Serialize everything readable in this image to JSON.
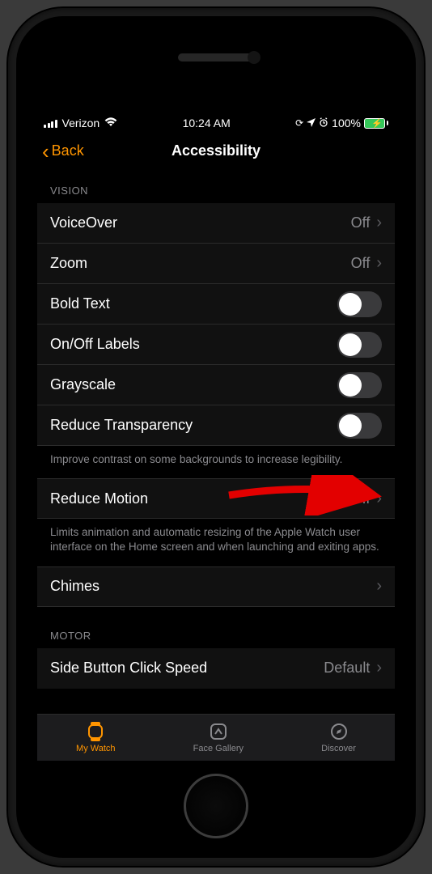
{
  "status": {
    "carrier": "Verizon",
    "time": "10:24 AM",
    "battery_pct": "100%"
  },
  "nav": {
    "back": "Back",
    "title": "Accessibility"
  },
  "sections": {
    "vision": {
      "header": "VISION",
      "voiceover": {
        "label": "VoiceOver",
        "value": "Off"
      },
      "zoom": {
        "label": "Zoom",
        "value": "Off"
      },
      "bold": {
        "label": "Bold Text"
      },
      "onoff": {
        "label": "On/Off Labels"
      },
      "grayscale": {
        "label": "Grayscale"
      },
      "reduce_transparency": {
        "label": "Reduce Transparency"
      },
      "footer1": "Improve contrast on some backgrounds to increase legibility."
    },
    "motion": {
      "reduce_motion": {
        "label": "Reduce Motion",
        "value": "Off"
      },
      "footer": "Limits animation and automatic resizing of the Apple Watch user interface on the Home screen and when launching and exiting apps."
    },
    "chimes": {
      "label": "Chimes"
    },
    "motor": {
      "header": "MOTOR",
      "side_button": {
        "label": "Side Button Click Speed",
        "value": "Default"
      }
    }
  },
  "tabs": {
    "mywatch": "My Watch",
    "gallery": "Face Gallery",
    "discover": "Discover"
  }
}
